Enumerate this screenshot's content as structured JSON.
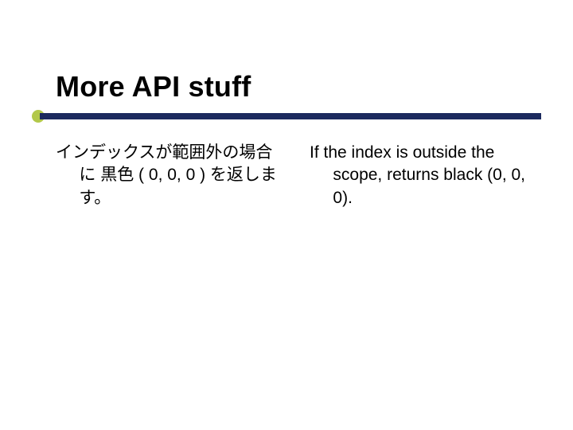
{
  "title": "More API stuff",
  "left_text": "インデックスが範囲外の場合に 黒色 ( 0, 0, 0 ) を返します。",
  "right_text": "If the index is outside the scope, returns black (0, 0, 0)."
}
